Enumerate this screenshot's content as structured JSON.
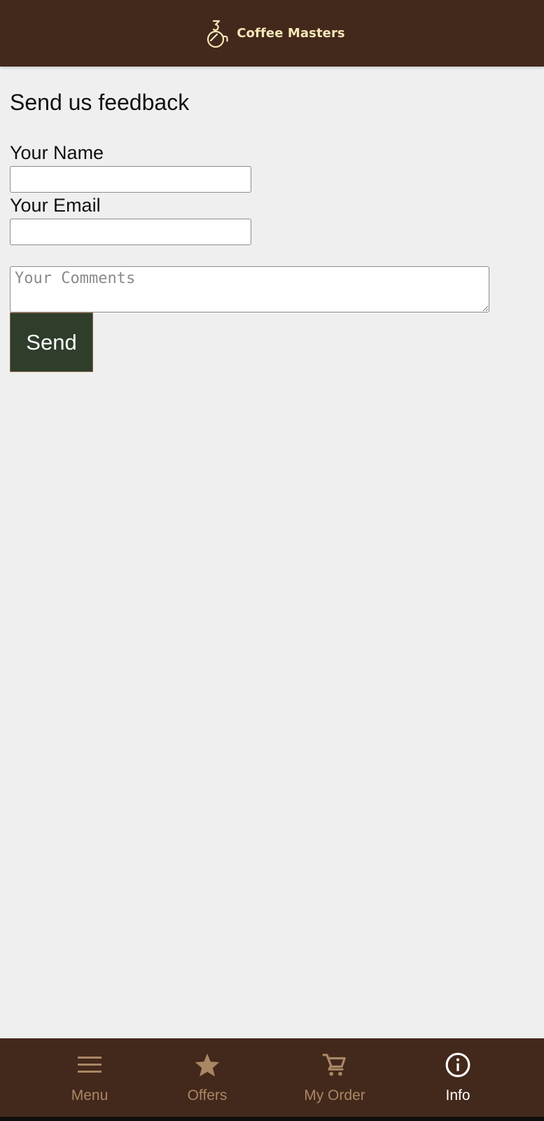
{
  "header": {
    "brand_name": "Coffee Masters",
    "logo_icon": "coffee-cup-logo"
  },
  "feedback": {
    "title": "Send us feedback",
    "name_label": "Your Name",
    "name_value": "",
    "email_label": "Your Email",
    "email_value": "",
    "comments_placeholder": "Your Comments",
    "send_label": "Send"
  },
  "nav": {
    "items": [
      {
        "label": "Menu",
        "icon": "menu-icon",
        "active": false
      },
      {
        "label": "Offers",
        "icon": "star-icon",
        "active": false
      },
      {
        "label": "My Order",
        "icon": "cart-icon",
        "active": false
      },
      {
        "label": "Info",
        "icon": "info-icon",
        "active": true
      }
    ]
  },
  "colors": {
    "header_bg": "#43281c",
    "brand_text": "#f5e7b8",
    "page_bg": "#efefef",
    "send_button_bg": "#2f3d2b",
    "nav_inactive": "#a98763",
    "nav_active": "#ffffff"
  }
}
